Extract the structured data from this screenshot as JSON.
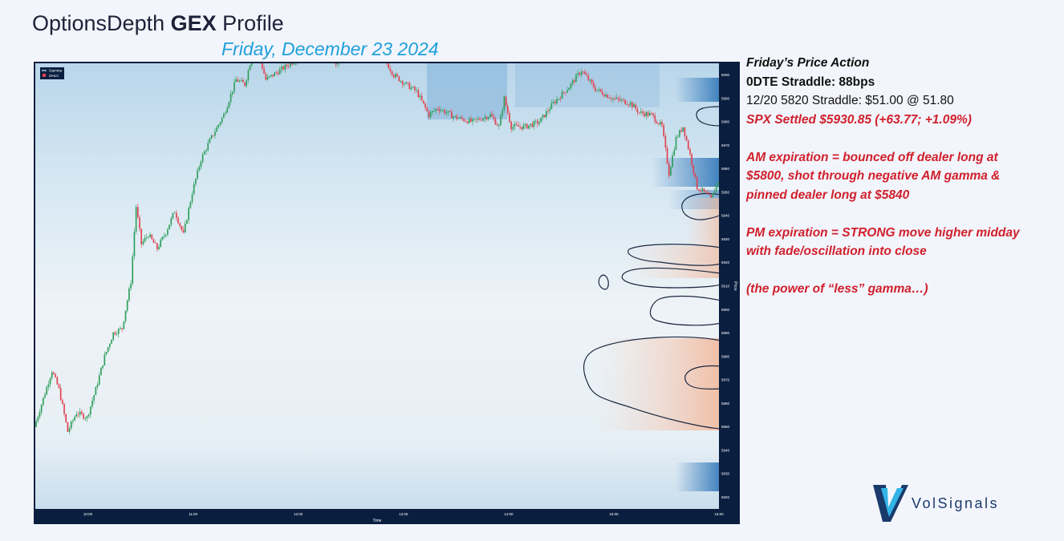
{
  "header": {
    "brand": "OptionsDepth",
    "bold_word": "GEX",
    "suffix": "Profile",
    "date": "Friday, December 23 2024"
  },
  "notes": {
    "heading": "Friday’s Price Action",
    "straddle": "0DTE Straddle: 88bps",
    "straddle_1220": "12/20 5820 Straddle: $51.00 @ 51.80",
    "settled": "SPX Settled $5930.85 (+63.77; +1.09%)",
    "am_lines": [
      "AM expiration = bounced off dealer long at",
      "$5800, shot through negative AM gamma &",
      "pinned dealer long at $5840"
    ],
    "pm_lines": [
      "PM expiration = STRONG move higher midday",
      "with fade/oscillation into close"
    ],
    "footer_note": "(the power of “less” gamma…)"
  },
  "logo": {
    "text": "VolSignals"
  },
  "colors": {
    "up": "#2e9e5b",
    "down": "#e0424e",
    "frame": "#0a1f3f",
    "positive_gamma": "#2f76b8",
    "negative_gamma": "#f2c1a8"
  },
  "chart_data": {
    "type": "candlestick",
    "title": "",
    "xlabel": "Time",
    "ylabel": "Price",
    "x_ticks": [
      "10:00",
      "11:00",
      "12:00",
      "13:00",
      "14:00",
      "15:00",
      "16:00"
    ],
    "x_range": [
      "09:30",
      "16:00"
    ],
    "y_ticks": [
      5820,
      5830,
      5840,
      5850,
      5860,
      5870,
      5880,
      5890,
      5900,
      5910,
      5920,
      5930,
      5940,
      5950,
      5960,
      5970,
      5980,
      5990,
      6000
    ],
    "ylim": [
      5815,
      6005
    ],
    "legend": [
      "Gamma",
      "OHLC"
    ],
    "legend_position": "top-left",
    "heatmap": "gamma exposure by strike over time (blue = positive, orange = negative)",
    "price_path": [
      [
        0,
        5850
      ],
      [
        5,
        5862
      ],
      [
        10,
        5874
      ],
      [
        14,
        5866
      ],
      [
        19,
        5848
      ],
      [
        24,
        5856
      ],
      [
        30,
        5854
      ],
      [
        35,
        5866
      ],
      [
        40,
        5880
      ],
      [
        45,
        5890
      ],
      [
        50,
        5892
      ],
      [
        55,
        5912
      ],
      [
        58,
        5944
      ],
      [
        61,
        5928
      ],
      [
        65,
        5932
      ],
      [
        70,
        5926
      ],
      [
        75,
        5933
      ],
      [
        80,
        5942
      ],
      [
        85,
        5932
      ],
      [
        90,
        5950
      ],
      [
        95,
        5964
      ],
      [
        100,
        5972
      ],
      [
        108,
        5983
      ],
      [
        115,
        5998
      ],
      [
        120,
        5996
      ],
      [
        126,
        6014
      ],
      [
        132,
        5998
      ],
      [
        140,
        6002
      ],
      [
        148,
        6006
      ],
      [
        155,
        6012
      ],
      [
        160,
        6010
      ],
      [
        166,
        6020
      ],
      [
        172,
        6004
      ],
      [
        180,
        6012
      ],
      [
        186,
        6012
      ],
      [
        192,
        6014
      ],
      [
        198,
        6009
      ],
      [
        205,
        6000
      ],
      [
        212,
        5996
      ],
      [
        218,
        5993
      ],
      [
        225,
        5983
      ],
      [
        230,
        5986
      ],
      [
        240,
        5982
      ],
      [
        250,
        5980
      ],
      [
        260,
        5983
      ],
      [
        265,
        5978
      ],
      [
        268,
        5990
      ],
      [
        272,
        5978
      ],
      [
        280,
        5978
      ],
      [
        288,
        5980
      ],
      [
        296,
        5988
      ],
      [
        305,
        5995
      ],
      [
        312,
        6002
      ],
      [
        320,
        5994
      ],
      [
        330,
        5990
      ],
      [
        340,
        5988
      ],
      [
        345,
        5984
      ],
      [
        352,
        5983
      ],
      [
        358,
        5978
      ],
      [
        362,
        5958
      ],
      [
        366,
        5973
      ],
      [
        370,
        5978
      ],
      [
        374,
        5966
      ],
      [
        378,
        5952
      ],
      [
        382,
        5950
      ],
      [
        386,
        5947
      ],
      [
        390,
        5955
      ]
    ]
  }
}
